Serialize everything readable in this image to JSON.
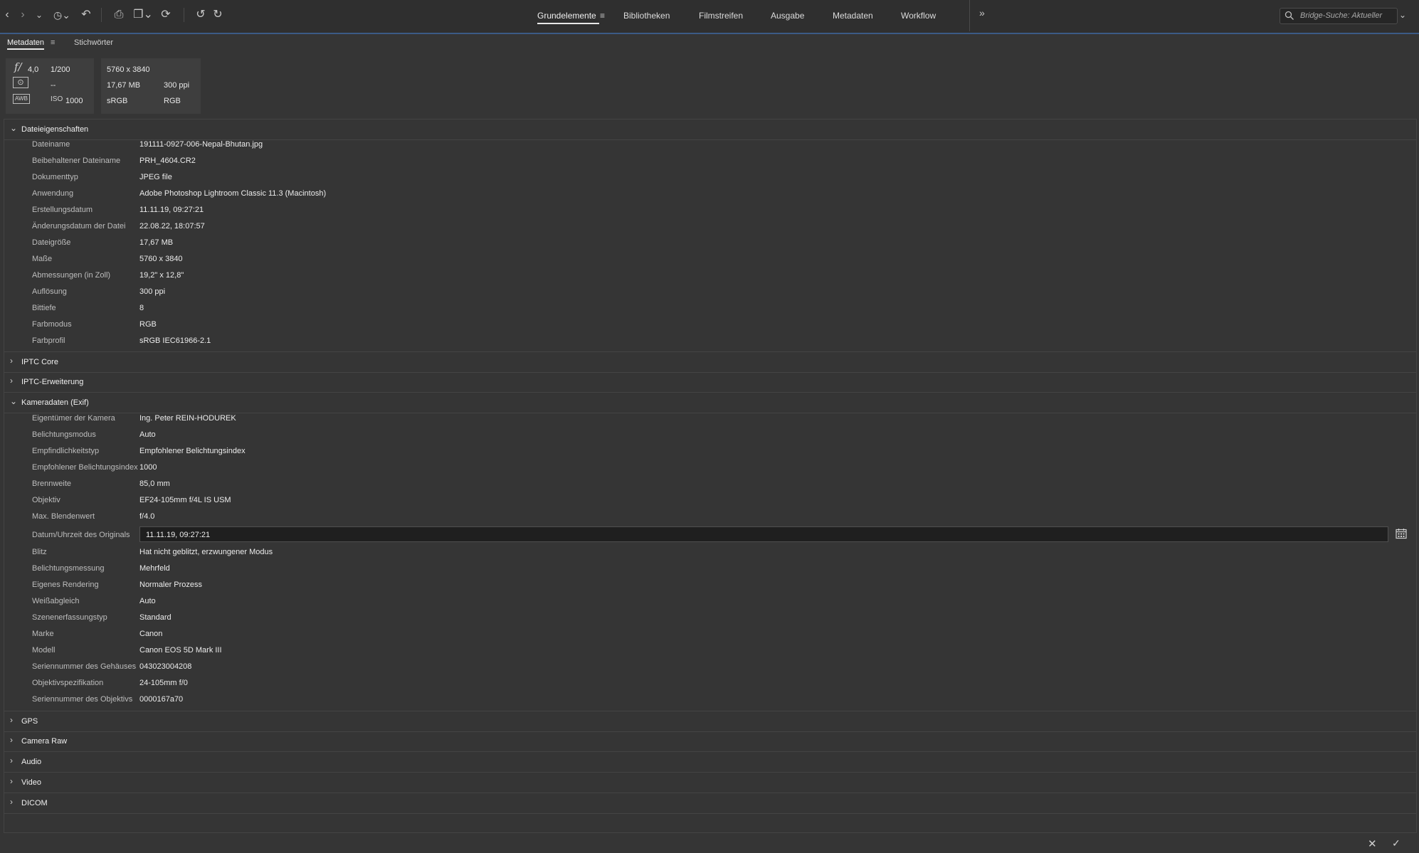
{
  "toolbar": {
    "back_label": "‹",
    "forward_label": "›",
    "recent_label": "⌄",
    "history_label": "◷⌄",
    "boomerang_label": "↶",
    "camera_label": "⎙",
    "copy_label": "❐⌄",
    "refine_label": "⟳",
    "rotate_left_label": "↺",
    "rotate_right_label": "↻",
    "more_label": "»"
  },
  "workspaces": [
    {
      "label": "Grundelemente",
      "active": true
    },
    {
      "label": "Bibliotheken"
    },
    {
      "label": "Filmstreifen"
    },
    {
      "label": "Ausgabe"
    },
    {
      "label": "Metadaten"
    },
    {
      "label": "Workflow"
    }
  ],
  "workspace_menu_label": "≡",
  "search": {
    "placeholder": "Bridge-Suche: Aktueller",
    "dropdown": "⌄"
  },
  "panel_tabs": {
    "metadaten": "Metadaten",
    "stichwoerter": "Stichwörter",
    "menu": "≡"
  },
  "exposure": {
    "aperture_icon": "f/",
    "aperture": "4,0",
    "shutter": "1/200",
    "metering_icon": "⊙",
    "exposure_comp": "--",
    "wb_icon": "AWB",
    "iso_label": "ISO",
    "iso": "1000",
    "dimensions": "5760 x 3840",
    "filesize": "17,67 MB",
    "resolution": "300 ppi",
    "colorprofile": "sRGB",
    "colormode": "RGB"
  },
  "sections": {
    "datei": {
      "title": "Dateieigenschaften",
      "chevron": "⌄",
      "rows": [
        {
          "k": "Dateiname",
          "v": "191111-0927-006-Nepal-Bhutan.jpg"
        },
        {
          "k": "Beibehaltener Dateiname",
          "v": "PRH_4604.CR2"
        },
        {
          "k": "Dokumenttyp",
          "v": "JPEG file"
        },
        {
          "k": "Anwendung",
          "v": "Adobe Photoshop Lightroom Classic 11.3 (Macintosh)"
        },
        {
          "k": "Erstellungsdatum",
          "v": "11.11.19, 09:27:21"
        },
        {
          "k": "Änderungsdatum der Datei",
          "v": "22.08.22, 18:07:57"
        },
        {
          "k": "Dateigröße",
          "v": "17,67 MB"
        },
        {
          "k": "Maße",
          "v": "5760 x 3840"
        },
        {
          "k": "Abmessungen (in Zoll)",
          "v": "19,2\" x 12,8\""
        },
        {
          "k": "Auflösung",
          "v": "300 ppi"
        },
        {
          "k": "Bittiefe",
          "v": "8"
        },
        {
          "k": "Farbmodus",
          "v": "RGB"
        },
        {
          "k": "Farbprofil",
          "v": "sRGB IEC61966-2.1"
        }
      ]
    },
    "iptc_core": {
      "title": "IPTC Core",
      "chevron": "›"
    },
    "iptc_ext": {
      "title": "IPTC-Erweiterung",
      "chevron": "›"
    },
    "kamera": {
      "title": "Kameradaten (Exif)",
      "chevron": "⌄",
      "rows": [
        {
          "k": "Eigentümer der Kamera",
          "v": "Ing. Peter REIN-HODUREK"
        },
        {
          "k": "Belichtungsmodus",
          "v": "Auto"
        },
        {
          "k": "Empfindlichkeitstyp",
          "v": "Empfohlener Belichtungsindex"
        },
        {
          "k": "Empfohlener Belichtungsindex",
          "v": "1000"
        },
        {
          "k": "Brennweite",
          "v": "85,0 mm"
        },
        {
          "k": "Objektiv",
          "v": "EF24-105mm f/4L IS USM"
        },
        {
          "k": "Max. Blendenwert",
          "v": "f/4.0"
        },
        {
          "k": "Datum/Uhrzeit des Originals",
          "v": "11.11.19, 09:27:21",
          "editable": true
        },
        {
          "k": "Blitz",
          "v": "Hat nicht geblitzt, erzwungener Modus"
        },
        {
          "k": "Belichtungsmessung",
          "v": "Mehrfeld"
        },
        {
          "k": "Eigenes Rendering",
          "v": "Normaler Prozess"
        },
        {
          "k": "Weißabgleich",
          "v": "Auto"
        },
        {
          "k": "Szenenerfassungstyp",
          "v": "Standard"
        },
        {
          "k": "Marke",
          "v": "Canon"
        },
        {
          "k": "Modell",
          "v": "Canon EOS 5D Mark III"
        },
        {
          "k": "Seriennummer des Gehäuses",
          "v": "043023004208"
        },
        {
          "k": "Objektivspezifikation",
          "v": "24-105mm f/0"
        },
        {
          "k": "Seriennummer des Objektivs",
          "v": "0000167a70"
        }
      ]
    },
    "gps": {
      "title": "GPS",
      "chevron": "›"
    },
    "camera_raw": {
      "title": "Camera Raw",
      "chevron": "›"
    },
    "audio": {
      "title": "Audio",
      "chevron": "›"
    },
    "video": {
      "title": "Video",
      "chevron": "›"
    },
    "dicom": {
      "title": "DICOM",
      "chevron": "›"
    }
  },
  "footer": {
    "cancel": "✕",
    "apply": "✓"
  }
}
